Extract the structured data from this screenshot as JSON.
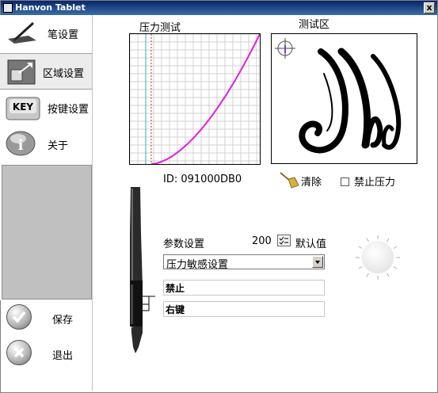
{
  "window": {
    "title": "Hanvon Tablet",
    "close_label": "x"
  },
  "sidebar": {
    "items": [
      {
        "label": "笔设置",
        "icon": "pen-icon"
      },
      {
        "label": "区域设置",
        "icon": "area-icon"
      },
      {
        "label": "按键设置",
        "icon": "key-icon",
        "icon_text": "KEY"
      },
      {
        "label": "关于",
        "icon": "info-icon",
        "icon_text": "i"
      }
    ],
    "active_index": 1,
    "save_label": "保存",
    "exit_label": "退出"
  },
  "pressure_test": {
    "title": "压力测试",
    "curve_color": "#e020e0"
  },
  "test_area": {
    "title": "测试区"
  },
  "device": {
    "id_text": "ID: 091000DB0"
  },
  "actions": {
    "clear_label": "清除",
    "disable_pressure_label": "禁止压力",
    "disable_pressure_checked": false
  },
  "params": {
    "label": "参数设置",
    "value": "200",
    "default_label": "默认值",
    "select_value": "压力敏感设置",
    "field1_value": "禁止",
    "field2_value": "右键"
  }
}
